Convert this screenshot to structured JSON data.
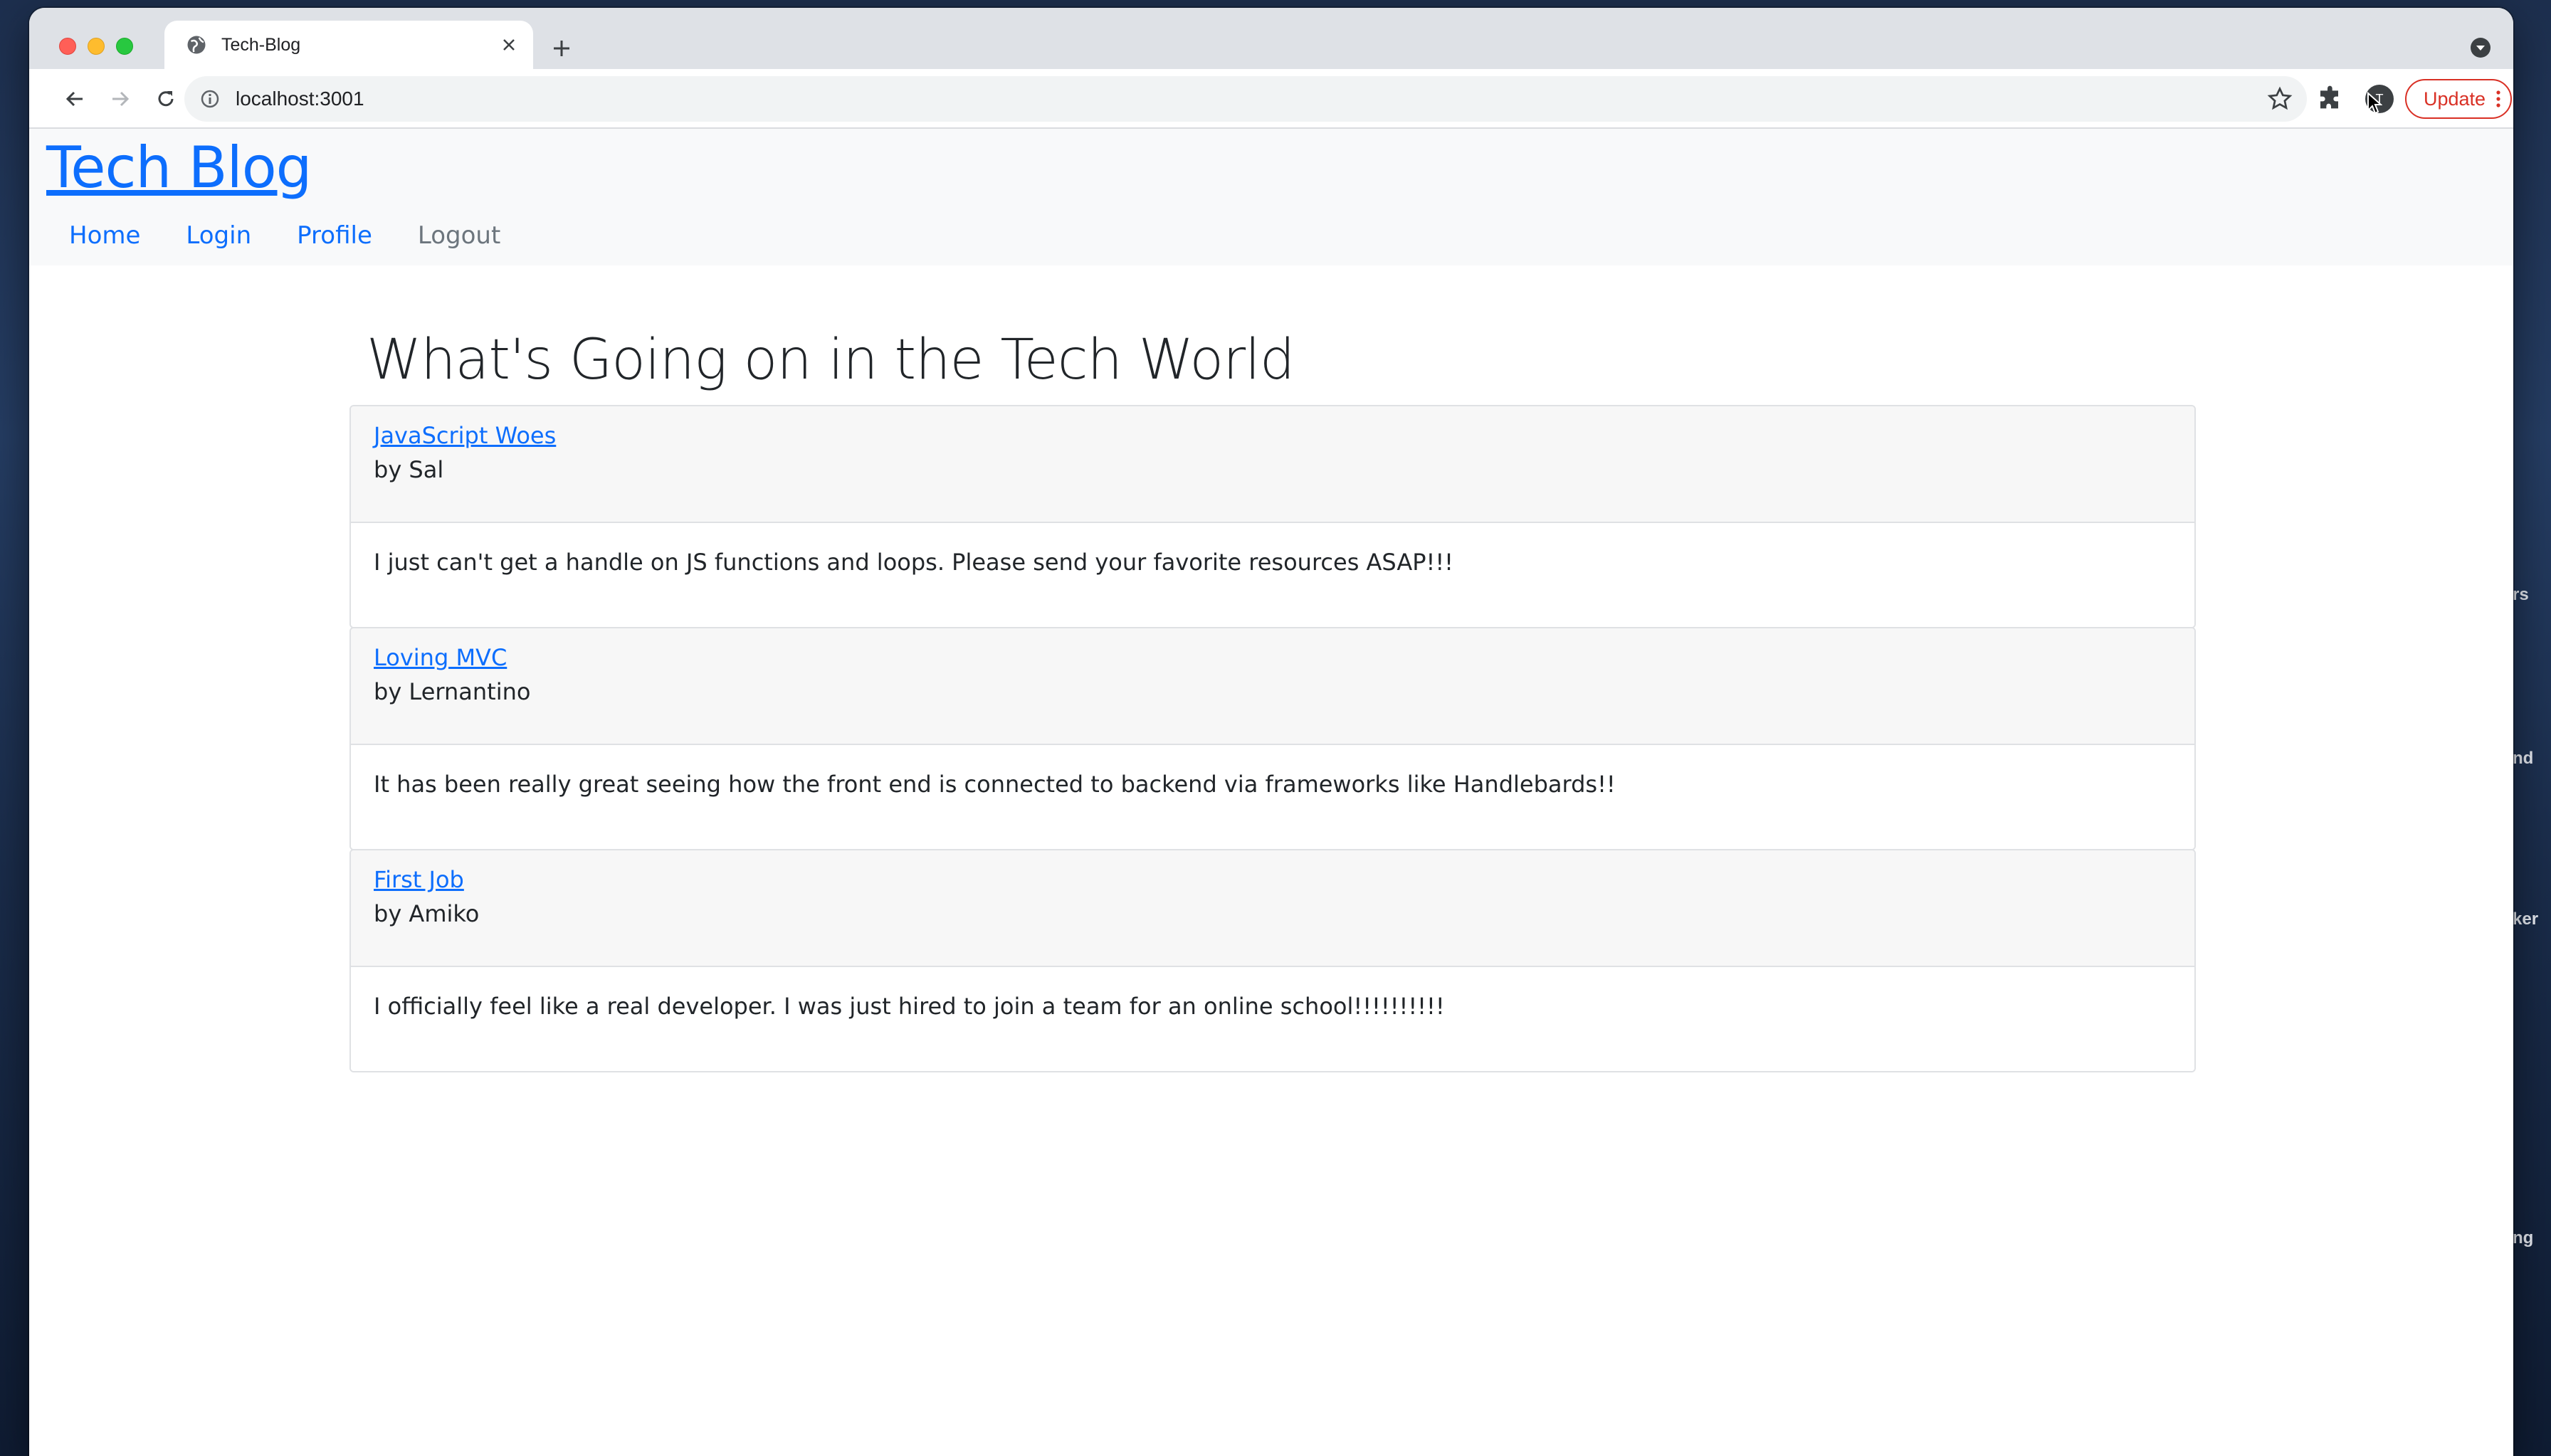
{
  "browser": {
    "tab_title": "Tech-Blog",
    "url": "localhost:3001",
    "update_label": "Update",
    "avatar_initial": "T"
  },
  "desktop": {
    "labels": [
      "rs",
      "nd",
      "ker",
      "ng"
    ]
  },
  "site": {
    "brand": "Tech Blog",
    "nav": [
      {
        "label": "Home"
      },
      {
        "label": "Login"
      },
      {
        "label": "Profile"
      },
      {
        "label": "Logout"
      }
    ]
  },
  "main": {
    "title": "What's Going on in the Tech World",
    "posts": [
      {
        "title": "JavaScript Woes",
        "author": "by Sal",
        "body": "I just can't get a handle on JS functions and loops. Please send your favorite resources ASAP!!!"
      },
      {
        "title": "Loving MVC",
        "author": "by Lernantino",
        "body": "It has been really great seeing how the front end is connected to backend via frameworks like Handlebards!!"
      },
      {
        "title": "First Job",
        "author": "by Amiko",
        "body": "I officially feel like a real developer. I was just hired to join a team for an online school!!!!!!!!!!"
      }
    ]
  },
  "colors": {
    "link": "#0d6efd",
    "muted": "#6c757d",
    "update": "#d93025"
  }
}
